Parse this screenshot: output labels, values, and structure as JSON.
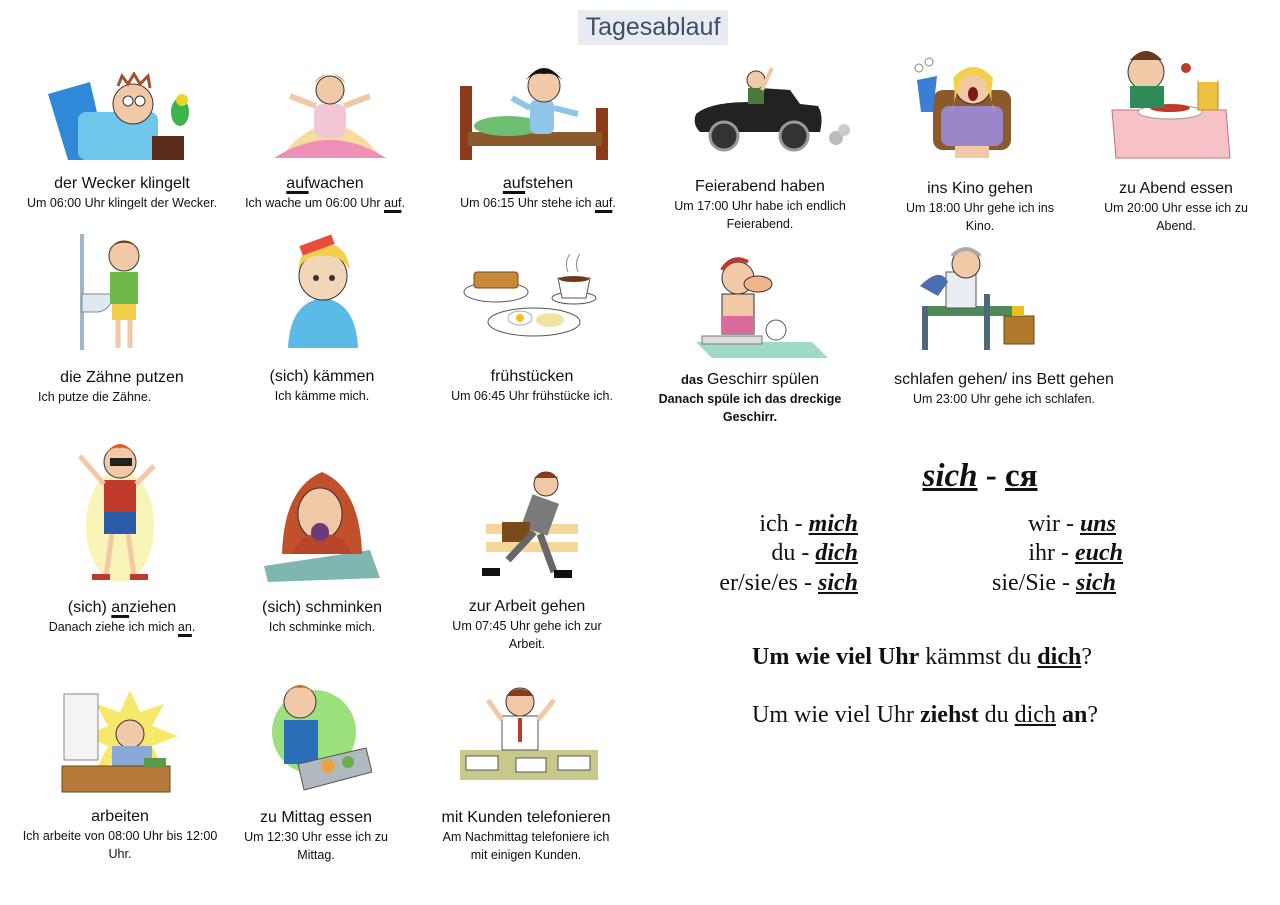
{
  "title": "Tagesablauf",
  "activities": [
    {
      "pre": "der Wecker klingelt",
      "und": "",
      "post": "",
      "s_pre": "Um 06:00 Uhr klingelt der Wecker.",
      "s_und": "",
      "s_post": ""
    },
    {
      "pre": "",
      "und": "auf",
      "post": "wachen",
      "s_pre": "Ich wache um 06:00 Uhr ",
      "s_und": "auf",
      "s_post": "."
    },
    {
      "pre": "",
      "und": "auf",
      "post": "stehen",
      "s_pre": "Um 06:15 Uhr stehe ich ",
      "s_und": "auf",
      "s_post": "."
    },
    {
      "pre": "Feierabend haben",
      "und": "",
      "post": "",
      "s_pre": "Um 17:00 Uhr habe ich endlich Feierabend.",
      "s_und": "",
      "s_post": ""
    },
    {
      "pre": "ins Kino gehen",
      "und": "",
      "post": "",
      "s_pre": "Um 18:00 Uhr gehe ich ins Kino.",
      "s_und": "",
      "s_post": ""
    },
    {
      "pre": "zu Abend essen",
      "und": "",
      "post": "",
      "s_pre": "Um 20:00 Uhr esse ich zu Abend.",
      "s_und": "",
      "s_post": ""
    },
    {
      "pre": "die Zähne putzen",
      "und": "",
      "post": "",
      "s_pre": "Ich putze die Zähne.",
      "s_und": "",
      "s_post": ""
    },
    {
      "pre": "(sich) kämmen",
      "und": "",
      "post": "",
      "s_pre": "Ich kämme mich.",
      "s_und": "",
      "s_post": ""
    },
    {
      "pre": "frühstücken",
      "und": "",
      "post": "",
      "s_pre": "Um 06:45 Uhr frühstücke ich.",
      "s_und": "",
      "s_post": ""
    },
    {
      "pre": "das ",
      "und": "",
      "post": "Geschirr spülen",
      "s_pre": "Danach spüle ich das dreckige Geschirr.",
      "s_und": "",
      "s_post": ""
    },
    {
      "pre": "schlafen gehen/ ins Bett gehen",
      "und": "",
      "post": "",
      "s_pre": "Um 23:00 Uhr gehe ich schlafen.",
      "s_und": "",
      "s_post": ""
    },
    {
      "pre": "(sich) ",
      "und": "an",
      "post": "ziehen",
      "s_pre": "Danach ziehe ich mich ",
      "s_und": "an",
      "s_post": "."
    },
    {
      "pre": "(sich) schminken",
      "und": "",
      "post": "",
      "s_pre": "Ich schminke mich.",
      "s_und": "",
      "s_post": ""
    },
    {
      "pre": "zur Arbeit gehen",
      "und": "",
      "post": "",
      "s_pre": "Um 07:45 Uhr gehe ich zur Arbeit.",
      "s_und": "",
      "s_post": ""
    },
    {
      "pre": "arbeiten",
      "und": "",
      "post": "",
      "s_pre": "Ich arbeite von 08:00 Uhr bis 12:00 Uhr.",
      "s_und": "",
      "s_post": ""
    },
    {
      "pre": "zu Mittag essen",
      "und": "",
      "post": "",
      "s_pre": "Um 12:30 Uhr esse ich zu Mittag.",
      "s_und": "",
      "s_post": ""
    },
    {
      "pre": "mit Kunden telefonieren",
      "und": "",
      "post": "",
      "s_pre": "Am Nachmittag telefoniere ich mit einigen Kunden.",
      "s_und": "",
      "s_post": ""
    }
  ],
  "grammar": {
    "heading_left": "sich",
    "heading_dash": "-",
    "heading_right": "ся",
    "pronouns": [
      {
        "p": "ich -",
        "r": "mich"
      },
      {
        "p": "du -",
        "r": "dich"
      },
      {
        "p": "er/sie/es -",
        "r": "sich"
      },
      {
        "p": "wir -",
        "r": "uns"
      },
      {
        "p": "ihr -",
        "r": "euch"
      },
      {
        "p": "sie/Sie -",
        "r": "sich"
      }
    ],
    "q1": {
      "a": "Um wie viel Uhr",
      "b": " kämmst du ",
      "c": "dich",
      "d": "?"
    },
    "q2": {
      "a": "Um wie viel Uhr ",
      "b": "ziehst",
      "c": " du ",
      "d": "dich",
      "e": " an",
      "f": "?"
    }
  }
}
